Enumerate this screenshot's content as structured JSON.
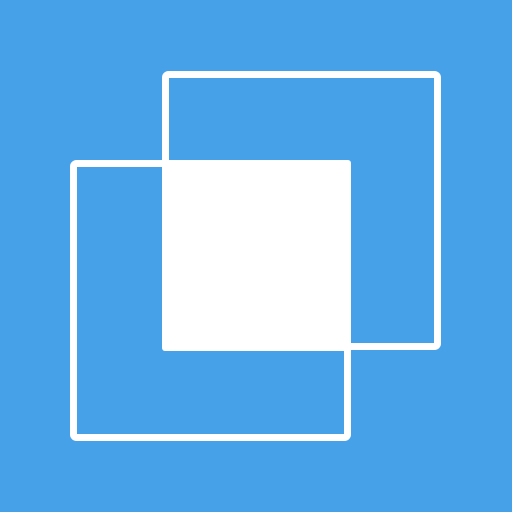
{
  "icon": {
    "name": "overlapping-squares-icon",
    "colors": {
      "background": "#46a1e8",
      "foreground": "#ffffff"
    }
  }
}
